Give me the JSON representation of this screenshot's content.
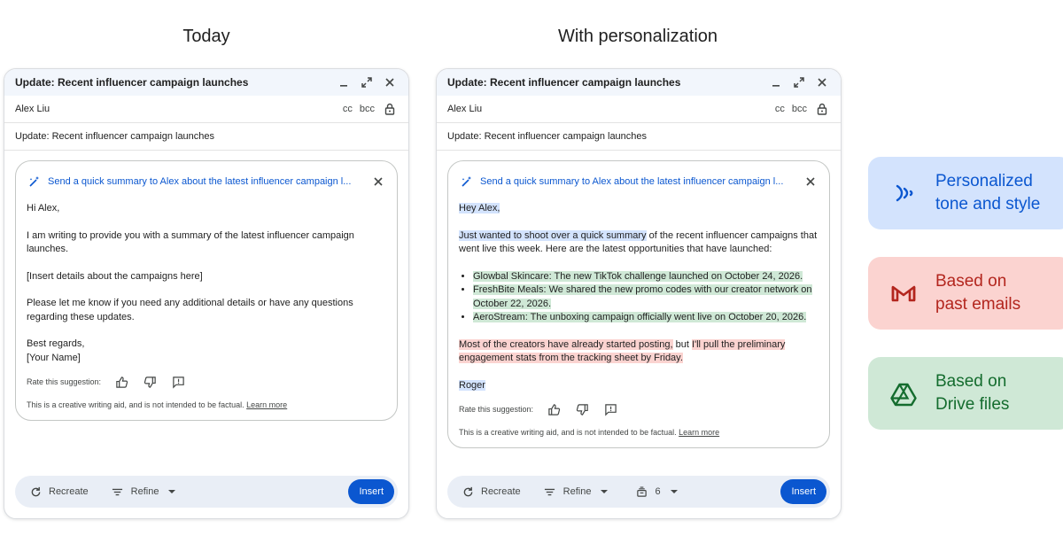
{
  "columns": {
    "left_title": "Today",
    "right_title": "With personalization"
  },
  "left": {
    "window_title": "Update: Recent influencer campaign launches",
    "to": "Alex Liu",
    "cc": "cc",
    "bcc": "bcc",
    "subject": "Update: Recent influencer campaign launches",
    "prompt": "Send a quick summary to Alex about the latest influencer campaign l...",
    "greeting": "Hi Alex,",
    "para1": "I am writing to provide you with a summary of the latest influencer campaign launches.",
    "para2": "[Insert details about the campaigns here]",
    "para3": "Please let me know if you need any additional details or have any questions regarding these updates.",
    "signoff1": "Best regards,",
    "signoff2": "[Your Name]",
    "rate_label": "Rate this suggestion:",
    "disclaimer": "This is a creative writing aid, and is not intended to be factual.",
    "learn_more": "Learn more",
    "recreate": "Recreate",
    "refine": "Refine",
    "insert": "Insert"
  },
  "right": {
    "window_title": "Update: Recent influencer campaign launches",
    "to": "Alex Liu",
    "cc": "cc",
    "bcc": "bcc",
    "subject": "Update: Recent influencer campaign launches",
    "prompt": "Send a quick summary to Alex about the latest influencer campaign l...",
    "greeting": "Hey Alex,",
    "para1_hl": "Just wanted to shoot over a quick summary",
    "para1_rest": " of the recent influencer campaigns that went live this week. Here are the latest opportunities that have launched:",
    "bullets": [
      "Glowbal Skincare: The new TikTok challenge launched on October 24, 2026.",
      "FreshBite Meals: We shared the new promo codes with our creator network on October 22, 2026.",
      "AeroStream: The unboxing campaign officially went live on October 20, 2026."
    ],
    "para2_hl1": "Most of the creators have already started posting,",
    "para2_mid": " but ",
    "para2_hl2": "I'll pull the preliminary engagement stats from the tracking sheet by Friday.",
    "signoff": "Roger",
    "rate_label": "Rate this suggestion:",
    "disclaimer": "This is a creative writing aid, and is not intended to be factual.",
    "learn_more": "Learn more",
    "recreate": "Recreate",
    "refine": "Refine",
    "sources_count": "6",
    "insert": "Insert"
  },
  "features": [
    {
      "line1": "Personalized",
      "line2": "tone and style",
      "icon": "voice-waves-icon",
      "bg": "#d3e3fd",
      "fg": "#0b57d0"
    },
    {
      "line1": "Based on",
      "line2": "past emails",
      "icon": "gmail-icon",
      "bg": "#fbd3d0",
      "fg": "#b3261e"
    },
    {
      "line1": "Based on",
      "line2": "Drive files",
      "icon": "drive-icon",
      "bg": "#cfe8d6",
      "fg": "#146c2e"
    }
  ],
  "colors": {
    "accent": "#0b57d0",
    "highlight_blue": "#d3e3fd",
    "highlight_green": "#cfe8d6",
    "highlight_red": "#fbd3d0"
  }
}
